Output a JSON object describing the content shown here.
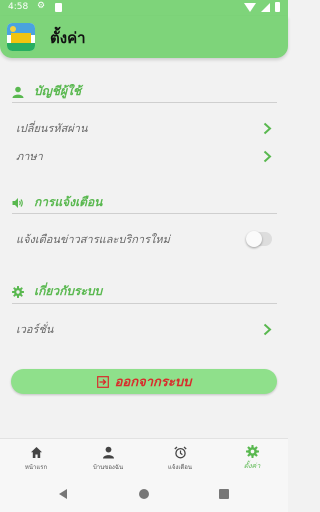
{
  "status_bar": {
    "time": "4:58"
  },
  "app_bar": {
    "title": "ตั้งค่า"
  },
  "sections": {
    "account": {
      "title": "บัญชีผู้ใช้",
      "items": [
        "เปลี่ยนรหัสผ่าน",
        "ภาษา"
      ]
    },
    "notifications": {
      "title": "การแจ้งเตือน",
      "items": [
        "แจ้งเตือนข่าวสารและบริการใหม่"
      ],
      "toggle_on": false
    },
    "system": {
      "title": "เกี่ยวกับระบบ",
      "items": [
        "เวอร์ชั่น"
      ]
    }
  },
  "logout": {
    "label": "ออกจากระบบ"
  },
  "bottom_nav": {
    "items": [
      "หน้าแรก",
      "บ้านของฉัน",
      "แจ้งเตือน",
      "ตั้งค่า"
    ],
    "active": "ตั้งค่า"
  },
  "colors": {
    "accent": "#7ed47a",
    "section_text": "#59b84f",
    "logout_text": "#d92b2b"
  },
  "icons": {
    "status": [
      "gear-icon",
      "sd-card-icon",
      "wifi-icon",
      "signal-icon",
      "battery-icon"
    ],
    "sections": [
      "person-icon",
      "speaker-icon",
      "gear-icon"
    ],
    "nav": [
      "home-icon",
      "person-icon",
      "alarm-clock-icon",
      "gear-icon"
    ],
    "logout": "logout-icon"
  }
}
